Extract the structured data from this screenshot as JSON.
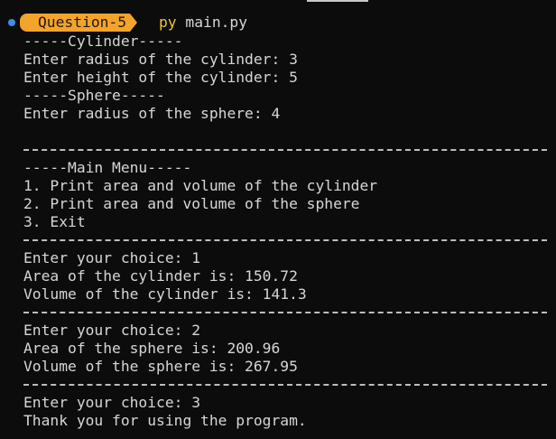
{
  "prompt": {
    "badge": "Question-5",
    "cmd_keyword": "py",
    "cmd_file": "main.py"
  },
  "output": [
    "-----Cylinder-----",
    "Enter radius of the cylinder: 3",
    "Enter height of the cylinder: 5",
    "-----Sphere-----",
    "Enter radius of the sphere: 4",
    "",
    "---SEP---",
    "-----Main Menu-----",
    "1. Print area and volume of the cylinder",
    "2. Print area and volume of the sphere",
    "3. Exit",
    "---SEP---",
    "Enter your choice: 1",
    "Area of the cylinder is: 150.72",
    "Volume of the cylinder is: 141.3",
    "---SEP---",
    "Enter your choice: 2",
    "Area of the sphere is: 200.96",
    "Volume of the sphere is: 267.95",
    "---SEP---",
    "Enter your choice: 3",
    "Thank you for using the program."
  ],
  "colors": {
    "background": "#0c0c0c",
    "text": "#d6d6d6",
    "badge": "#f4a32b",
    "py_keyword": "#f1c232",
    "status_dot": "#3b8eea"
  }
}
